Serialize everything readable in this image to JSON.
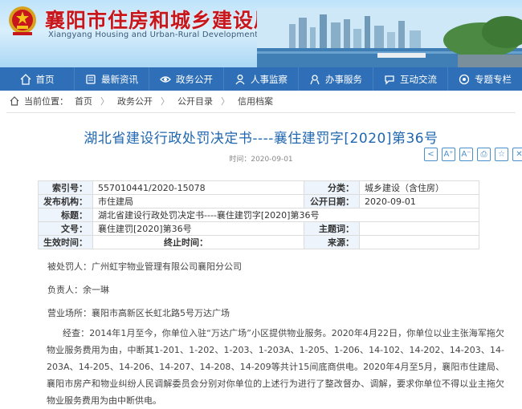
{
  "header": {
    "title": "襄阳市住房和城乡建设局",
    "subtitle": "Xiangyang Housing and Urban-Rural Development Bureau"
  },
  "nav": [
    {
      "label": "首页",
      "icon": "home-icon"
    },
    {
      "label": "最新资讯",
      "icon": "news-icon"
    },
    {
      "label": "政务公开",
      "icon": "eye-icon"
    },
    {
      "label": "人事监察",
      "icon": "person-icon"
    },
    {
      "label": "办事服务",
      "icon": "service-icon"
    },
    {
      "label": "互动交流",
      "icon": "chat-icon"
    },
    {
      "label": "专题专栏",
      "icon": "topic-icon"
    }
  ],
  "breadcrumb": {
    "prefix": "当前位置：",
    "items": [
      "首页",
      "政务公开",
      "公开目录",
      "信用档案"
    ]
  },
  "document": {
    "title": "湖北省建设行政处罚决定书----襄住建罚字[2020]第36号",
    "date": "时间：2020-09-01",
    "tools": [
      "share-icon",
      "font-increase-icon",
      "font-decrease-icon",
      "print-icon",
      "favorite-icon",
      "close-icon"
    ]
  },
  "info": {
    "index_label": "索引号：",
    "index_value": "557010441/2020-15078",
    "category_label": "分类：",
    "category_value": "城乡建设（含住房）",
    "publisher_label": "发布机构：",
    "publisher_value": "市住建局",
    "pubdate_label": "公开日期：",
    "pubdate_value": "2020-09-01",
    "title_label": "标题：",
    "title_value": "湖北省建设行政处罚决定书----襄住建罚字[2020]第36号",
    "docno_label": "文号：",
    "docno_value": "襄住建罚[2020]第36号",
    "subject_label": "主题词：",
    "subject_value": "",
    "effective_label": "生效时间：",
    "effective_value": "",
    "end_label": "终止时间：",
    "end_value": "",
    "source_label": "来源：",
    "source_value": ""
  },
  "content": {
    "penalized": "被处罚人：广州虹宇物业管理有限公司襄阳分公司",
    "responsible": "负责人：余一琳",
    "address": "营业场所：襄阳市高新区长虹北路5号万达广场",
    "body": "经查：2014年1月至今，你单位入驻“万达广场”小区提供物业服务。2020年4月22日，你单位以业主张海军拖欠物业服务费用为由，中断其1-201、1-202、1-203、1-203A、1-205、1-206、14-102、14-202、14-203、14-203A、14-205、14-206、14-207、14-208、14-209等共计15间底商供电。2020年4月至5月，襄阳市住建局、襄阳市房产和物业纠纷人民调解委员会分别对你单位的上述行为进行了整改督办、调解，要求你单位不得以业主拖欠物业服务费用为由中断供电。"
  }
}
